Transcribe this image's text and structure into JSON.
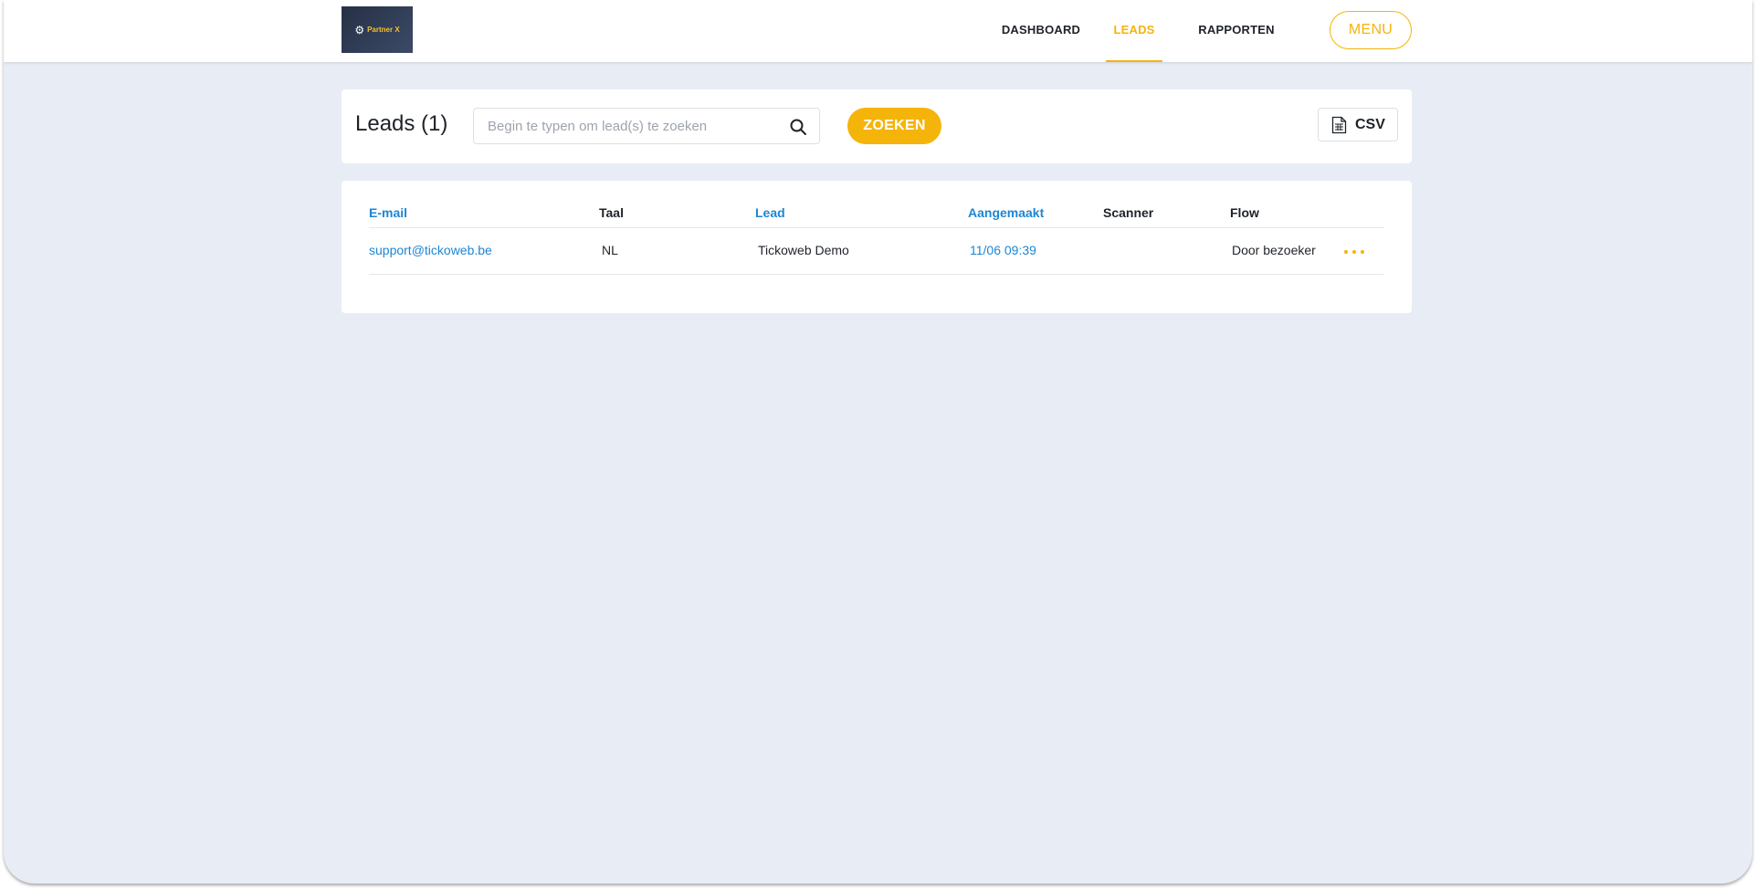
{
  "header": {
    "logo_text": "Partner X",
    "nav": {
      "dashboard": "DASHBOARD",
      "leads": "LEADS",
      "reports": "RAPPORTEN"
    },
    "menu_label": "MENU"
  },
  "toolbar": {
    "title": "Leads (1)",
    "search_placeholder": "Begin te typen om lead(s) te zoeken",
    "search_value": "",
    "search_button": "ZOEKEN",
    "export_label": "CSV"
  },
  "table": {
    "columns": {
      "email": "E-mail",
      "taal": "Taal",
      "lead": "Lead",
      "aangemaakt": "Aangemaakt",
      "scanner": "Scanner",
      "flow": "Flow"
    },
    "rows": [
      {
        "email": "support@tickoweb.be",
        "taal": "NL",
        "lead": "Tickoweb Demo",
        "aangemaakt": "11/06 09:39",
        "scanner": "",
        "flow": "Door bezoeker"
      }
    ]
  },
  "colors": {
    "accent": "#f5b40a",
    "link": "#1d86d4",
    "background": "#e8edf5"
  },
  "icons": {
    "search": "search-icon",
    "export": "spreadsheet-icon",
    "row_actions": "more-horizontal-icon",
    "logo": "gear-icon"
  }
}
